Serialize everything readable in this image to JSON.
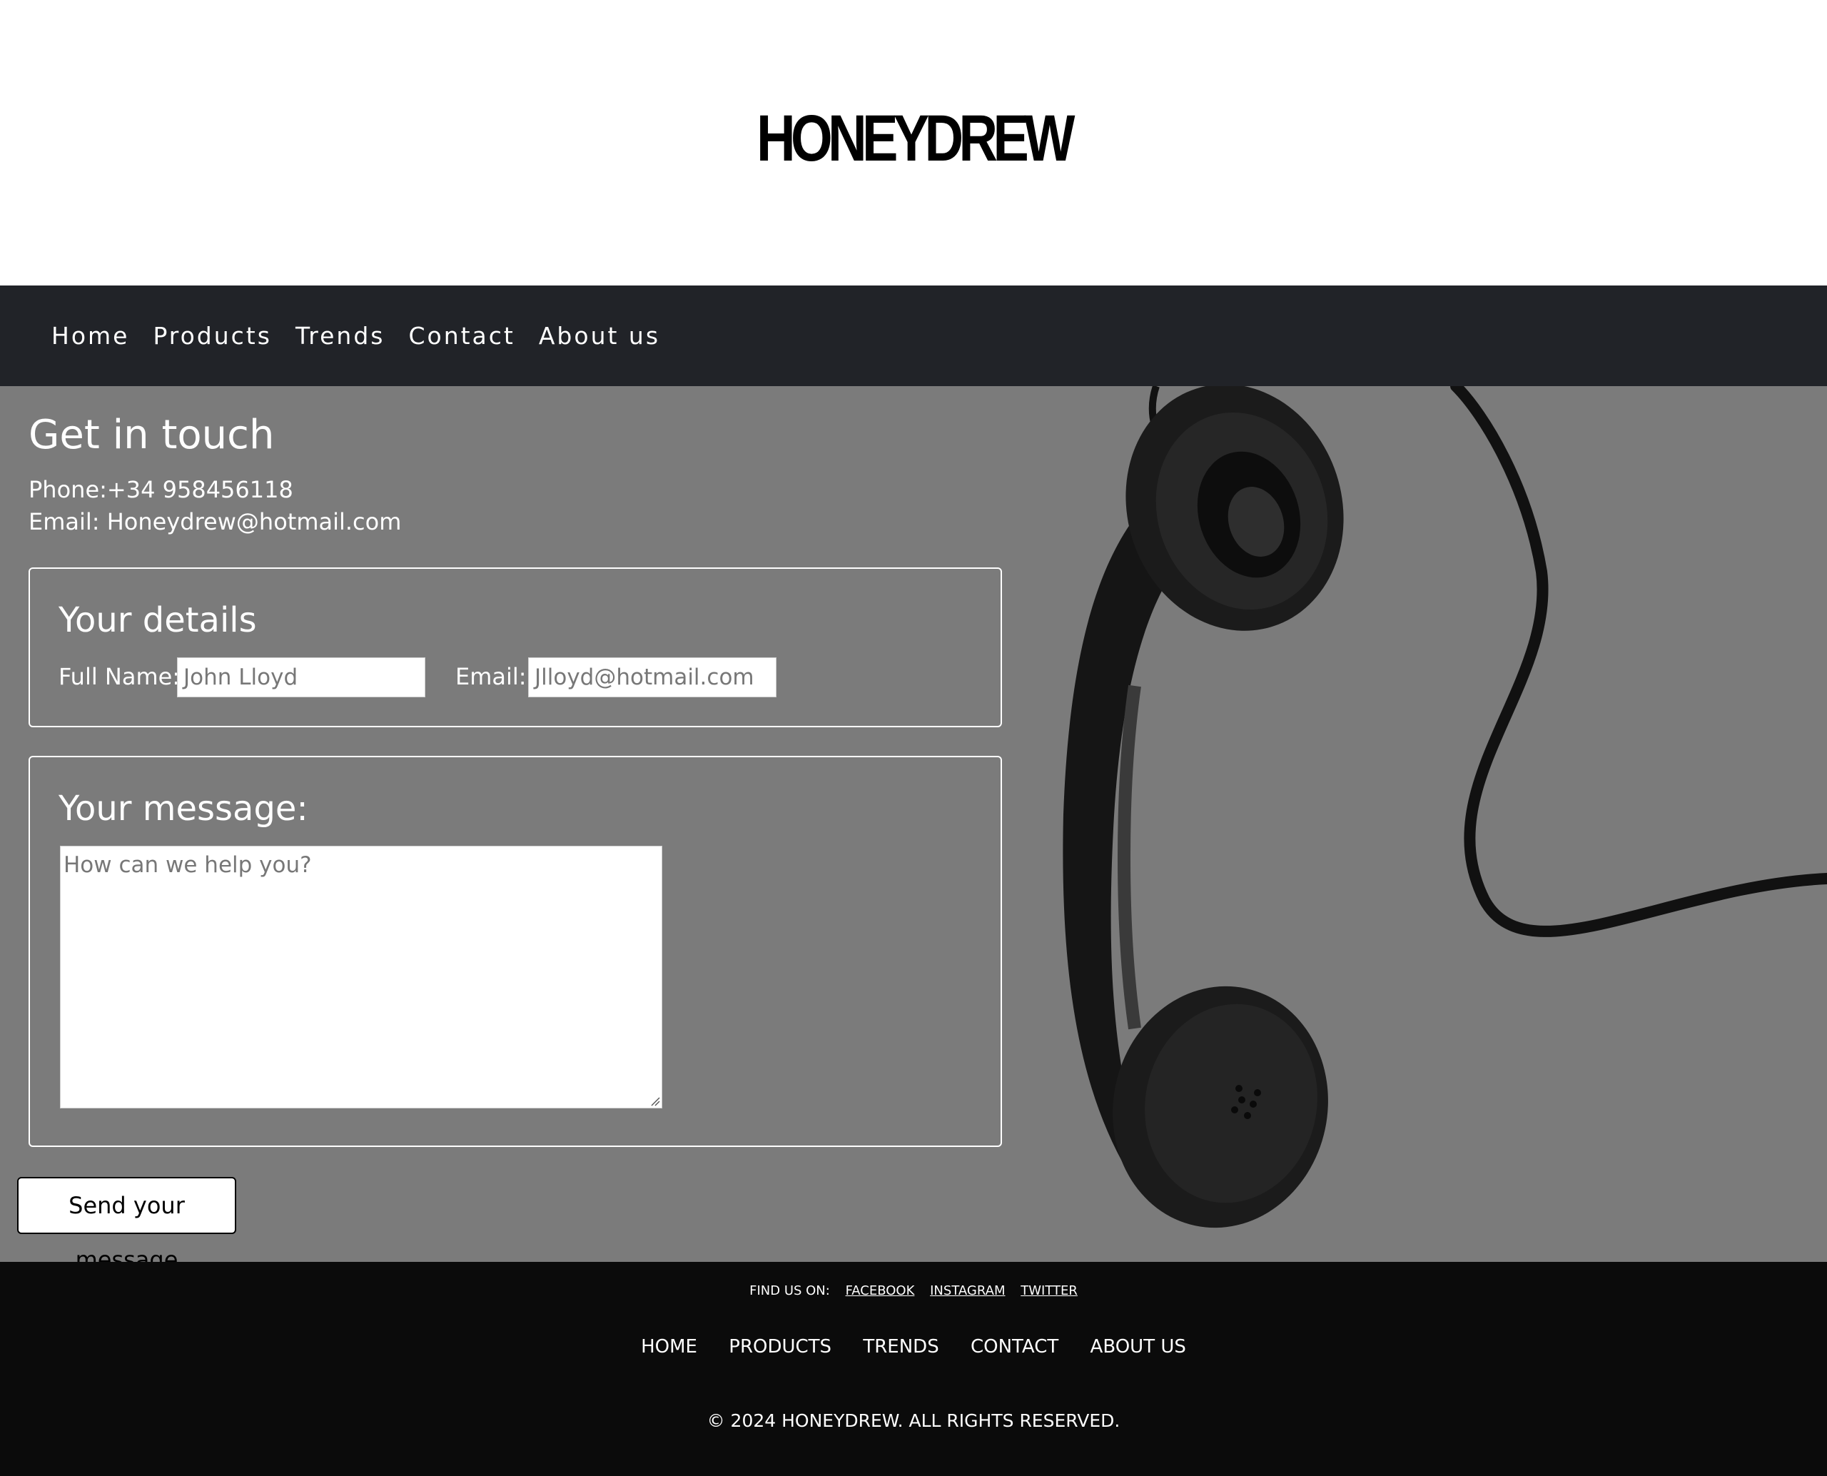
{
  "header": {
    "logo_text": "HONEYDREW"
  },
  "nav": {
    "items": [
      {
        "label": "Home"
      },
      {
        "label": "Products"
      },
      {
        "label": "Trends"
      },
      {
        "label": "Contact"
      },
      {
        "label": "About us"
      }
    ]
  },
  "contact": {
    "title": "Get in touch",
    "phone": "Phone:+34 958456118",
    "email": "Email: Honeydrew@hotmail.com",
    "details": {
      "legend": "Your details",
      "name_label": "Full Name:",
      "name_placeholder": "John Lloyd",
      "email_label": "Email:",
      "email_placeholder": "Jlloyd@hotmail.com"
    },
    "message": {
      "legend": "Your message:",
      "placeholder": "How can we help you?"
    },
    "send_label": "Send your message"
  },
  "footer": {
    "find_us": "FIND US ON:",
    "social": [
      {
        "label": "FACEBOOK"
      },
      {
        "label": "INSTAGRAM"
      },
      {
        "label": "TWITTER"
      }
    ],
    "links": [
      {
        "label": "HOME"
      },
      {
        "label": "PRODUCTS"
      },
      {
        "label": "TRENDS"
      },
      {
        "label": "CONTACT"
      },
      {
        "label": "ABOUT US"
      }
    ],
    "copyright": "© 2024 HONEYDREW. ALL RIGHTS RESERVED."
  },
  "colors": {
    "nav_bg": "#212328",
    "hero_bg": "#7b7b7b",
    "footer_bg": "#0b0b0b"
  }
}
